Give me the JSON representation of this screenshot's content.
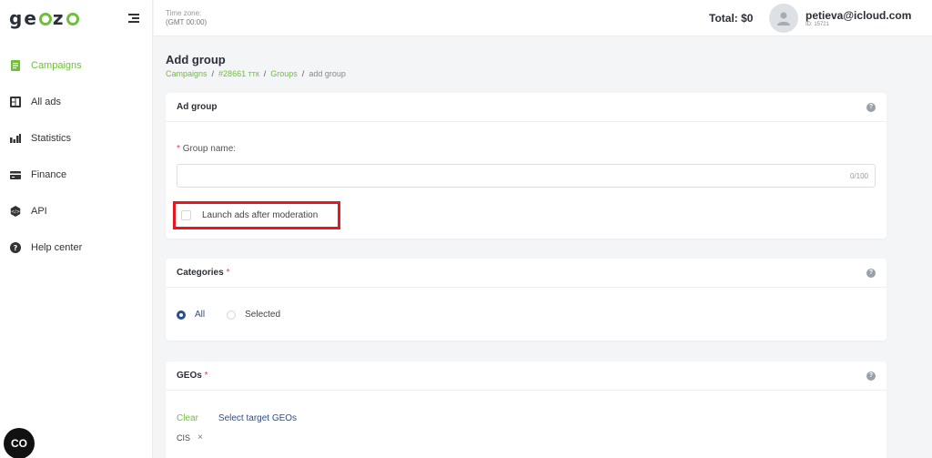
{
  "sidebar": {
    "logo": {
      "prefix": "ge",
      "middle": "z",
      "suffix": ""
    },
    "items": [
      {
        "label": "Campaigns",
        "icon": "campaigns-icon",
        "active": true
      },
      {
        "label": "All ads",
        "icon": "ads-icon"
      },
      {
        "label": "Statistics",
        "icon": "statistics-icon"
      },
      {
        "label": "Finance",
        "icon": "finance-icon"
      },
      {
        "label": "API",
        "icon": "api-icon"
      },
      {
        "label": "Help center",
        "icon": "help-icon"
      }
    ]
  },
  "topbar": {
    "timezone_label": "Time zone:",
    "timezone_value": "(GMT 00:00)",
    "total": "Total: $0",
    "user_email": "petieva@icloud.com",
    "user_id": "ID: 15721"
  },
  "page": {
    "title": "Add group",
    "breadcrumb": [
      "Campaigns",
      "#28661 ттк",
      "Groups",
      "add group"
    ]
  },
  "ad_group": {
    "heading": "Ad group",
    "field_label": "Group name:",
    "required_mark": "*",
    "input_value": "",
    "counter": "0/100",
    "launch_label": "Launch ads after moderation"
  },
  "categories": {
    "heading": "Categories",
    "required_mark": "*",
    "options": [
      "All",
      "Selected"
    ],
    "selected": "All"
  },
  "geos": {
    "heading": "GEOs",
    "required_mark": "*",
    "clear_label": "Clear",
    "select_label": "Select target GEOs",
    "tags": [
      "CIS"
    ],
    "tag_remove": "×"
  },
  "fab_label": "CO",
  "help_glyph": "?",
  "colors": {
    "accent": "#6fbf3a",
    "primary": "#2a4d8f",
    "highlight": "#e8171d"
  }
}
